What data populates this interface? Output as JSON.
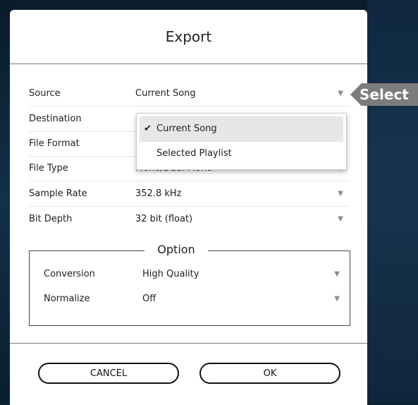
{
  "dialog": {
    "title": "Export"
  },
  "settings": [
    {
      "label": "Source",
      "value": "Current Song"
    },
    {
      "label": "Destination",
      "value": ""
    },
    {
      "label": "File Format",
      "value": ""
    },
    {
      "label": "File Type",
      "value": "Mono/Dual Mono"
    },
    {
      "label": "Sample Rate",
      "value": "352.8 kHz"
    },
    {
      "label": "Bit Depth",
      "value": "32 bit (float)"
    }
  ],
  "option": {
    "title": "Option",
    "rows": [
      {
        "label": "Conversion",
        "value": "High Quality"
      },
      {
        "label": "Normalize",
        "value": "Off"
      }
    ]
  },
  "dropdown": {
    "items": [
      {
        "label": "Current Song",
        "checked": true
      },
      {
        "label": "Selected Playlist",
        "checked": false
      }
    ],
    "check_glyph": "✔"
  },
  "buttons": {
    "cancel": "CANCEL",
    "ok": "OK"
  },
  "tooltip": {
    "label": "Select"
  },
  "icons": {
    "dropdown_arrow": "▼"
  },
  "colors": {
    "tooltip_bg": "#7c7c7c",
    "background": "#0e2236",
    "dialog_bg": "#ffffff"
  }
}
